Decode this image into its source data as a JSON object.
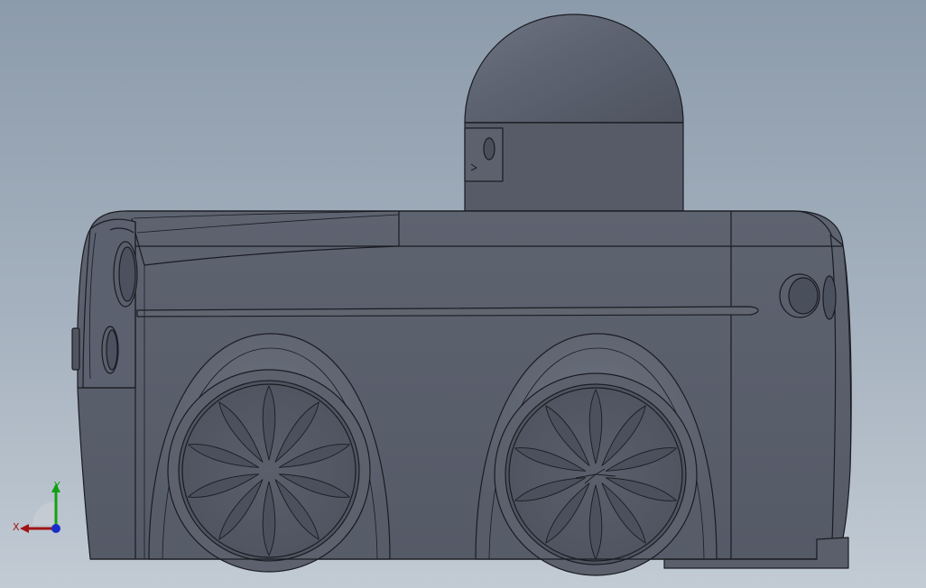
{
  "viewport": {
    "background_top": "#8c9bab",
    "background_bottom": "#c2cbd4"
  },
  "model": {
    "name": "robot-car",
    "body_color": "#5a5f6c",
    "edge_color": "#1a1c22"
  },
  "triad": {
    "x_label": "X",
    "y_label": "Y",
    "x_color": "#a01414",
    "y_color": "#12a012",
    "z_color": "#1a2cc8"
  }
}
